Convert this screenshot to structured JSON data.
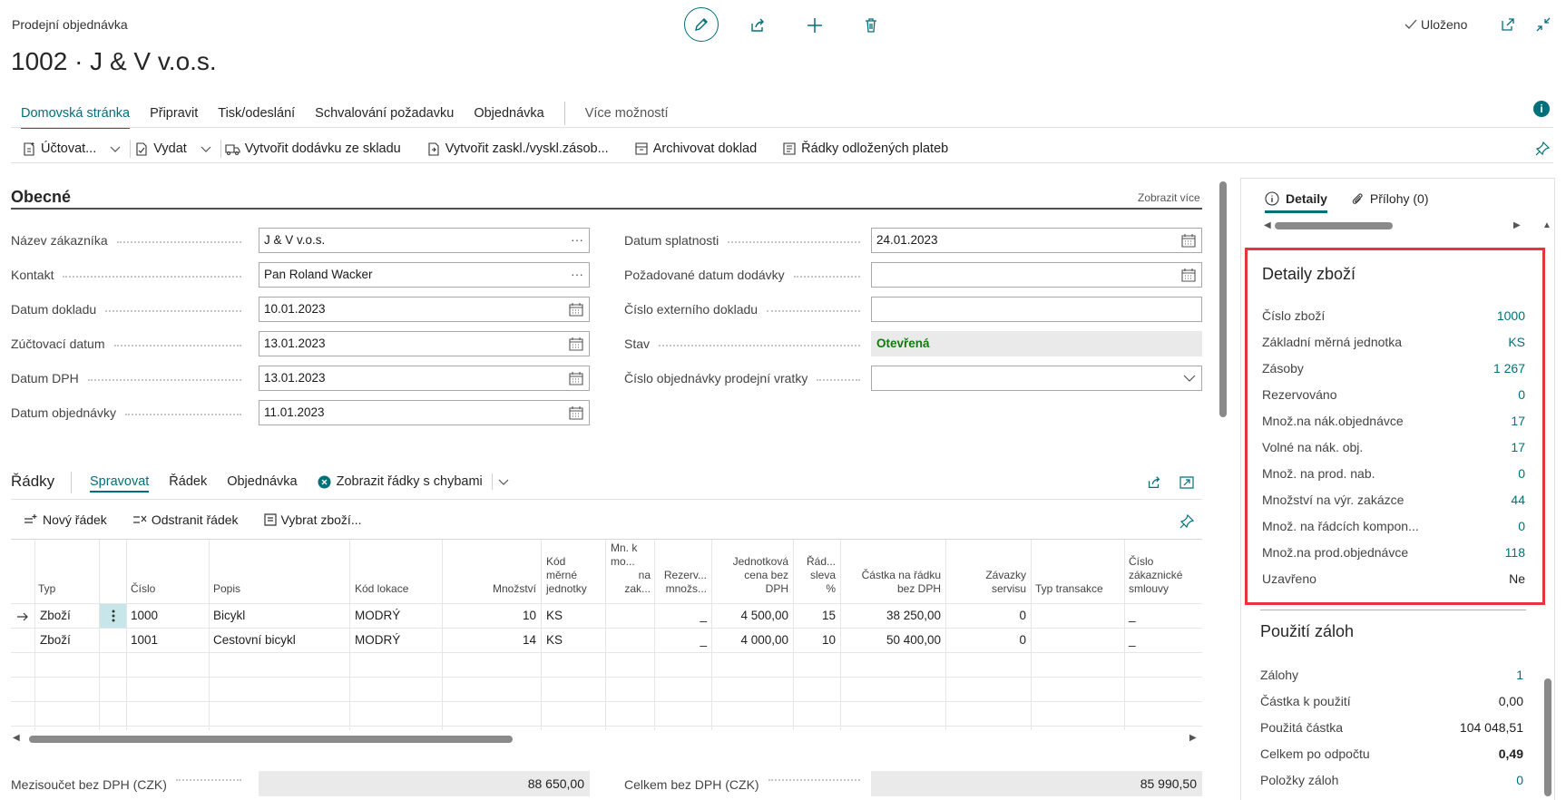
{
  "header": {
    "caption": "Prodejní objednávka",
    "title": "1002 · J & V v.o.s.",
    "saved_label": "Uloženo"
  },
  "action_tabs": [
    "Domovská stránka",
    "Připravit",
    "Tisk/odeslání",
    "Schvalování požadavku",
    "Objednávka"
  ],
  "action_more": "Více možností",
  "toolbar": {
    "post": "Účtovat...",
    "release": "Vydat",
    "create_whse_shipment": "Vytvořit dodávku ze skladu",
    "create_inv_putaway": "Vytvořit zaskl./vyskl.zásob...",
    "archive": "Archivovat doklad",
    "deferred_lines": "Řádky odložených plateb"
  },
  "general": {
    "title": "Obecné",
    "show_more": "Zobrazit více",
    "left_fields": [
      {
        "label": "Název zákazníka",
        "value": "J & V v.o.s."
      },
      {
        "label": "Kontakt",
        "value": "Pan Roland Wacker"
      },
      {
        "label": "Datum dokladu",
        "value": "10.01.2023"
      },
      {
        "label": "Zúčtovací datum",
        "value": "13.01.2023"
      },
      {
        "label": "Datum DPH",
        "value": "13.01.2023"
      },
      {
        "label": "Datum objednávky",
        "value": "11.01.2023"
      }
    ],
    "right_fields": [
      {
        "label": "Datum splatnosti",
        "value": "24.01.2023"
      },
      {
        "label": "Požadované datum dodávky",
        "value": ""
      },
      {
        "label": "Číslo externího dokladu",
        "value": ""
      },
      {
        "label": "Stav",
        "value": "Otevřená"
      },
      {
        "label": "Číslo objednávky prodejní vratky",
        "value": ""
      }
    ]
  },
  "lines": {
    "title": "Řádky",
    "tabs": [
      "Spravovat",
      "Řádek",
      "Objednávka"
    ],
    "show_errors": "Zobrazit řádky s chybami",
    "new_line": "Nový řádek",
    "delete_line": "Odstranit řádek",
    "select_items": "Vybrat zboží...",
    "headers": {
      "type": "Typ",
      "no": "Číslo",
      "desc": "Popis",
      "location": "Kód lokace",
      "qty": "Množství",
      "uom": [
        "Kód",
        "měrné",
        "jednotky"
      ],
      "qty_to_assemble": [
        "Mn. k",
        "mo...",
        "na",
        "zak..."
      ],
      "reserved": [
        "Rezerv...",
        "množs..."
      ],
      "unit_price": [
        "Jednotková",
        "cena bez",
        "DPH"
      ],
      "line_disc": [
        "Řád...",
        "sleva",
        "%"
      ],
      "line_amount": [
        "Částka na řádku",
        "bez DPH"
      ],
      "service_commit": [
        "Závazky",
        "servisu"
      ],
      "transaction_type": "Typ transakce",
      "contract": [
        "Číslo",
        "zákaznické",
        "smlouvy"
      ]
    },
    "rows": [
      {
        "type": "Zboží",
        "no": "1000",
        "desc": "Bicykl",
        "location": "MODRÝ",
        "qty": "10",
        "uom": "KS",
        "reserved": "_",
        "unit_price": "4 500,00",
        "disc": "15",
        "amount": "38 250,00",
        "service": "0",
        "contract": "_"
      },
      {
        "type": "Zboží",
        "no": "1001",
        "desc": "Cestovní bicykl",
        "location": "MODRÝ",
        "qty": "14",
        "uom": "KS",
        "reserved": "_",
        "unit_price": "4 000,00",
        "disc": "10",
        "amount": "50 400,00",
        "service": "0",
        "contract": "_"
      }
    ]
  },
  "totals": {
    "subtotal_label": "Mezisoučet bez DPH (CZK)",
    "subtotal_value": "88 650,00",
    "total_label": "Celkem bez DPH (CZK)",
    "total_value": "85 990,50"
  },
  "factbox": {
    "tab_details": "Detaily",
    "tab_attachments": "Přílohy (0)",
    "item_details": {
      "title": "Detaily zboží",
      "rows": [
        {
          "label": "Číslo zboží",
          "value": "1000"
        },
        {
          "label": "Základní měrná jednotka",
          "value": "KS"
        },
        {
          "label": "Zásoby",
          "value": "1 267"
        },
        {
          "label": "Rezervováno",
          "value": "0"
        },
        {
          "label": "Množ.na nák.objednávce",
          "value": "17"
        },
        {
          "label": "Volné na nák. obj.",
          "value": "17"
        },
        {
          "label": "Množ. na prod. nab.",
          "value": "0"
        },
        {
          "label": "Množství na výr. zakázce",
          "value": "44"
        },
        {
          "label": "Množ. na řádcích kompon...",
          "value": "0"
        },
        {
          "label": "Množ.na prod.objednávce",
          "value": "118"
        },
        {
          "label": "Uzavřeno",
          "value": "Ne"
        }
      ]
    },
    "prepayments": {
      "title": "Použití záloh",
      "rows": [
        {
          "label": "Zálohy",
          "value": "1"
        },
        {
          "label": "Částka k použití",
          "value": "0,00"
        },
        {
          "label": "Použitá částka",
          "value": "104 048,51"
        },
        {
          "label": "Celkem po odpočtu",
          "value": "0,49"
        },
        {
          "label": "Položky záloh",
          "value": "0"
        }
      ]
    }
  },
  "colors": {
    "accent": "#00707a",
    "highlight_border": "#e8333f",
    "status_green": "#107c10"
  }
}
